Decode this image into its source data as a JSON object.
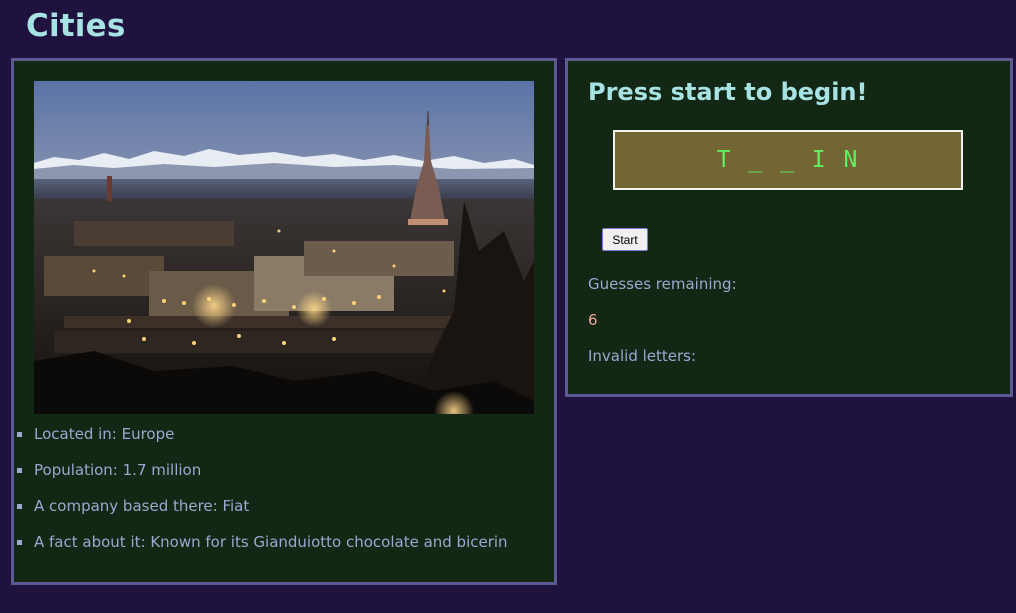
{
  "app": {
    "title": "Cities"
  },
  "city_card": {
    "photo_icon": "city-skyline-photo",
    "facts": [
      "Located in: Europe",
      "Population: 1.7 million",
      "A company based there: Fiat",
      "A fact about it: Known for its Gianduiotto chocolate and bicerin"
    ]
  },
  "game": {
    "prompt": "Press start to begin!",
    "word_display": "T _ _ I N",
    "start_label": "Start",
    "guesses_label": "Guesses remaining:",
    "guesses_value": "6",
    "invalid_label": "Invalid letters:",
    "invalid_value": ""
  },
  "colors": {
    "background": "#1f123e",
    "panel": "#132715",
    "panel_border": "#5c5a94",
    "heading": "#a8e3e3",
    "text": "#9ca8d0",
    "number": "#f4a79b",
    "word_box": "#736534",
    "word_letters": "#62f062"
  }
}
